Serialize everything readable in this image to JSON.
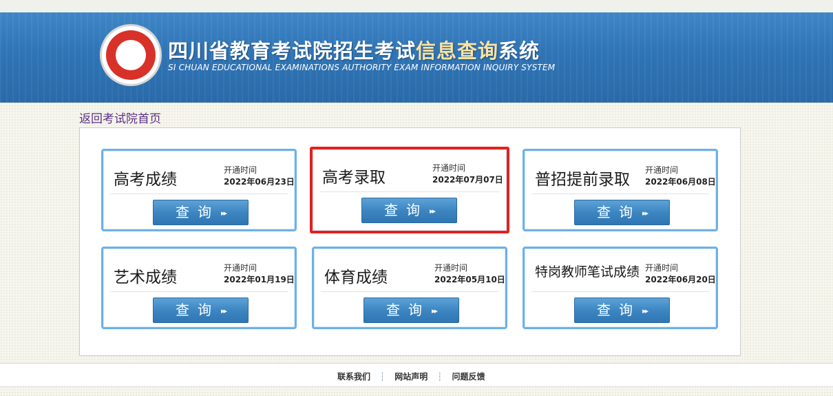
{
  "header": {
    "title_main": "四川省教育考试院招生考试",
    "title_highlight": "信息查询",
    "title_tail": "系统",
    "subtitle": "SI CHUAN EDUCATIONAL EXAMINATIONS AUTHORITY EXAM INFORMATION INQUIRY SYSTEM",
    "logo_icon": "seal-logo-icon"
  },
  "nav": {
    "back_label": "返回考试院首页"
  },
  "cards": [
    {
      "name": "高考成绩",
      "open_label": "开通时间",
      "date": "2022年06月23日",
      "button_label": "查询",
      "button_arrow": "▸▸"
    },
    {
      "name": "高考录取",
      "open_label": "开通时间",
      "date": "2022年07月07日",
      "button_label": "查询",
      "button_arrow": "▸▸"
    },
    {
      "name": "普招提前录取",
      "open_label": "开通时间",
      "date": "2022年06月08日",
      "button_label": "查询",
      "button_arrow": "▸▸"
    },
    {
      "name": "艺术成绩",
      "open_label": "开通时间",
      "date": "2022年01月19日",
      "button_label": "查询",
      "button_arrow": "▸▸"
    },
    {
      "name": "体育成绩",
      "open_label": "开通时间",
      "date": "2022年05月10日",
      "button_label": "查询",
      "button_arrow": "▸▸"
    },
    {
      "name": "特岗教师笔试成绩",
      "open_label": "开通时间",
      "date": "2022年06月20日",
      "button_label": "查询",
      "button_arrow": "▸▸"
    }
  ],
  "footer": {
    "links": [
      "联系我们",
      "网站声明",
      "问题反馈"
    ]
  },
  "colors": {
    "header_blue": "#2f74b5",
    "card_border": "#6fb0e8",
    "highlight_red": "#e5201c",
    "highlight_text": "#fbe3a1"
  }
}
